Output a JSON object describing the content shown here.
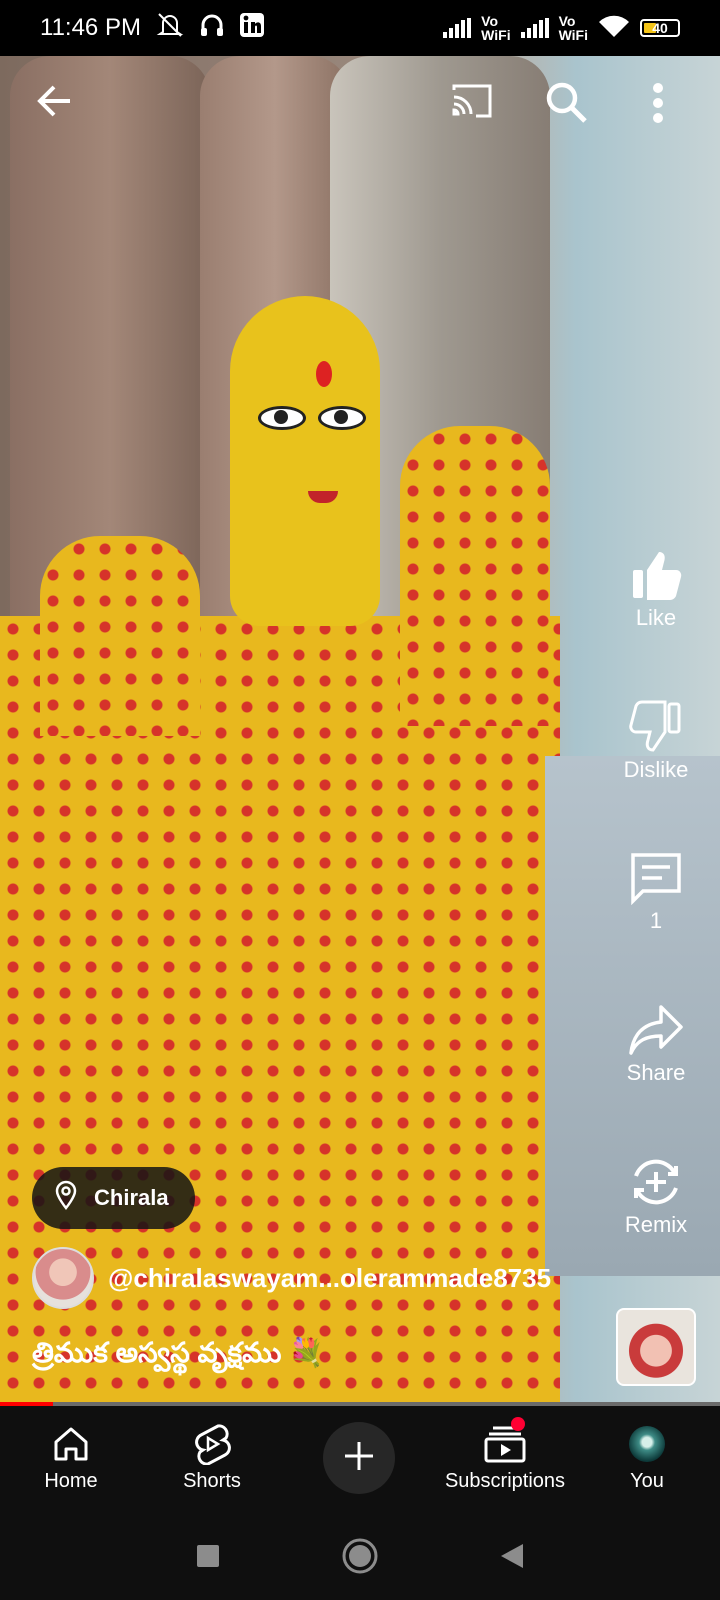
{
  "status_bar": {
    "time": "11:46 PM",
    "vo_label": "Vo",
    "wifi_label": "WiFi",
    "battery": "40",
    "icons": [
      "mute-icon",
      "headset-icon",
      "linkedin-icon",
      "signal-icon",
      "wifi-icon",
      "battery-icon"
    ]
  },
  "topbar": {
    "icons": [
      "back-arrow-icon",
      "cast-icon",
      "search-icon",
      "more-vert-icon"
    ]
  },
  "actions": {
    "like": "Like",
    "dislike": "Dislike",
    "comments": "1",
    "share": "Share",
    "remix": "Remix"
  },
  "video_info": {
    "location": "Chirala",
    "channel": "@chiralaswayam...olerammade8735",
    "caption": "త్రిముక అస్వస్థ వృక్షము 💐",
    "progress": 0.074
  },
  "navbar": {
    "items": [
      {
        "label": "Home",
        "icon": "home-icon"
      },
      {
        "label": "Shorts",
        "icon": "shorts-icon"
      },
      {
        "label": "",
        "icon": "plus-icon"
      },
      {
        "label": "Subscriptions",
        "icon": "subscriptions-icon"
      },
      {
        "label": "You",
        "icon": "avatar"
      }
    ]
  },
  "colors": {
    "accent_red": "#ff0000",
    "notification": "#ff0033",
    "background": "#0f0f0f"
  }
}
